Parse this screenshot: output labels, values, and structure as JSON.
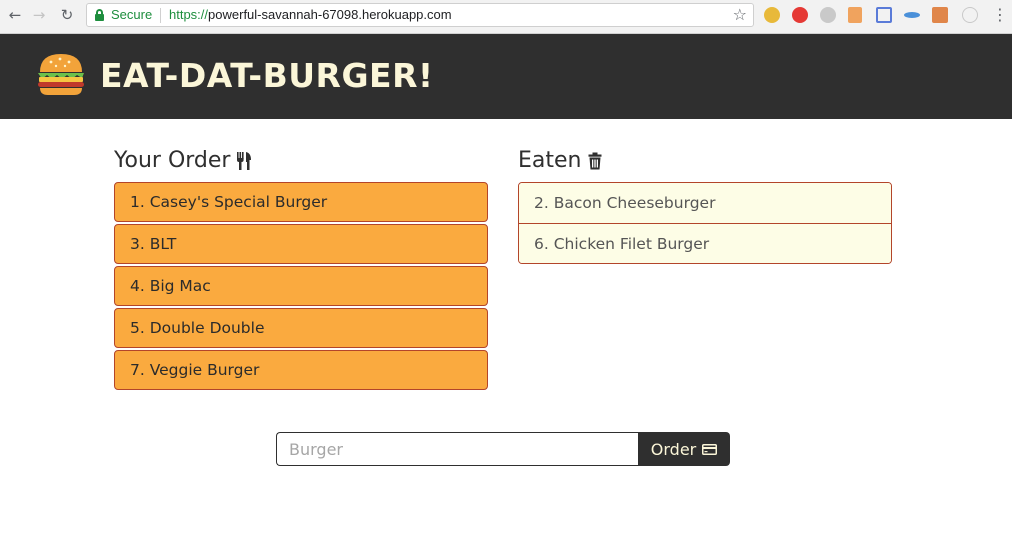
{
  "browser": {
    "security_label": "Secure",
    "url_scheme": "https://",
    "url_host": "powerful-savannah-67098.herokuapp.com"
  },
  "header": {
    "logo_icon": "burger-icon",
    "title": "Eat-Dat-Burger!"
  },
  "order_column": {
    "title": "Your Order",
    "icon": "utensils-icon",
    "items": [
      {
        "label": "1. Casey's Special Burger"
      },
      {
        "label": "3. BLT"
      },
      {
        "label": "4. Big Mac"
      },
      {
        "label": "5. Double Double"
      },
      {
        "label": "7. Veggie Burger"
      }
    ]
  },
  "eaten_column": {
    "title": "Eaten",
    "icon": "trash-icon",
    "items": [
      {
        "label": "2. Bacon Cheeseburger"
      },
      {
        "label": "6. Chicken Filet Burger"
      }
    ]
  },
  "order_form": {
    "input_placeholder": "Burger",
    "input_value": "",
    "button_label": "Order",
    "button_icon": "credit-card-icon"
  },
  "colors": {
    "header_bg": "#2f2f2f",
    "title_cream": "#fbf6d8",
    "order_item_bg": "#faaa3f",
    "eaten_item_bg": "#fdfde6",
    "item_border": "#b3452a"
  }
}
